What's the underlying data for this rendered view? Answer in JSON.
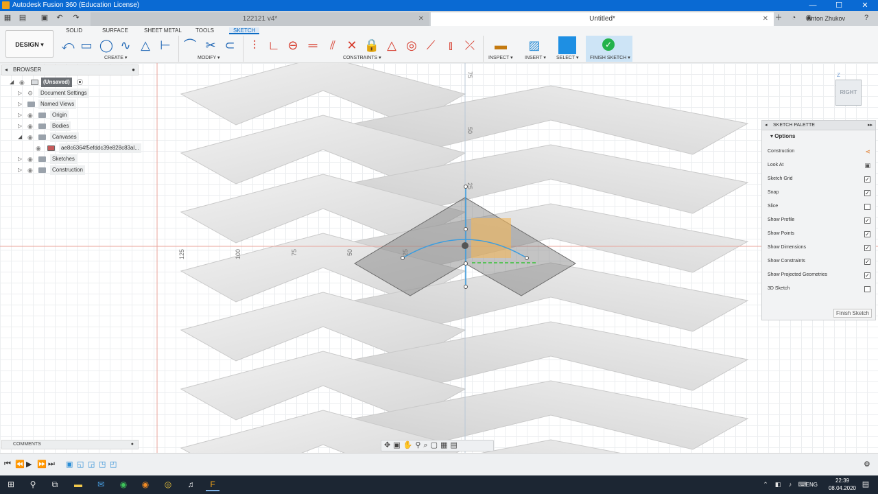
{
  "window": {
    "title": "Autodesk Fusion 360 (Education License)"
  },
  "tabs": [
    {
      "label": "122121 v4*"
    },
    {
      "label": "Untitled*"
    }
  ],
  "user": {
    "name": "Anton Zhukov"
  },
  "toolbar": {
    "mode": "DESIGN",
    "workspaces": [
      "SOLID",
      "SURFACE",
      "SHEET METAL",
      "TOOLS",
      "SKETCH"
    ],
    "groups": {
      "create": "CREATE",
      "modify": "MODIFY",
      "constraints": "CONSTRAINTS",
      "inspect": "INSPECT",
      "insert": "INSERT",
      "select": "SELECT",
      "finish": "FINISH SKETCH"
    }
  },
  "browser": {
    "title": "BROWSER",
    "items": [
      {
        "label": "(Unsaved)"
      },
      {
        "label": "Document Settings"
      },
      {
        "label": "Named Views"
      },
      {
        "label": "Origin"
      },
      {
        "label": "Bodies"
      },
      {
        "label": "Canvases"
      },
      {
        "label": "ae8c6364f5efddc39e828c83al..."
      },
      {
        "label": "Sketches"
      },
      {
        "label": "Construction"
      }
    ]
  },
  "comments": {
    "title": "COMMENTS"
  },
  "palette": {
    "title": "SKETCH PALETTE",
    "section": "Options",
    "options": [
      {
        "label": "Construction",
        "checked": null
      },
      {
        "label": "Look At",
        "checked": null
      },
      {
        "label": "Sketch Grid",
        "checked": true
      },
      {
        "label": "Snap",
        "checked": true
      },
      {
        "label": "Slice",
        "checked": false
      },
      {
        "label": "Show Profile",
        "checked": true
      },
      {
        "label": "Show Points",
        "checked": true
      },
      {
        "label": "Show Dimensions",
        "checked": true
      },
      {
        "label": "Show Constraints",
        "checked": true
      },
      {
        "label": "Show Projected Geometries",
        "checked": true
      },
      {
        "label": "3D Sketch",
        "checked": false
      }
    ],
    "finish_label": "Finish Sketch"
  },
  "viewcube": {
    "face": "RIGHT",
    "axis": "Z"
  },
  "rulers": {
    "horizontal": [
      "125",
      "100",
      "75",
      "50",
      "25"
    ],
    "vertical": [
      "75",
      "50",
      "25"
    ]
  },
  "taskbar": {
    "lang": "ENG",
    "time": "22:39",
    "date": "08.04.2020"
  },
  "colors": {
    "accent": "#0b6bc4",
    "constraint": "#d63a2b",
    "titlebar": "#0a6ad3"
  }
}
